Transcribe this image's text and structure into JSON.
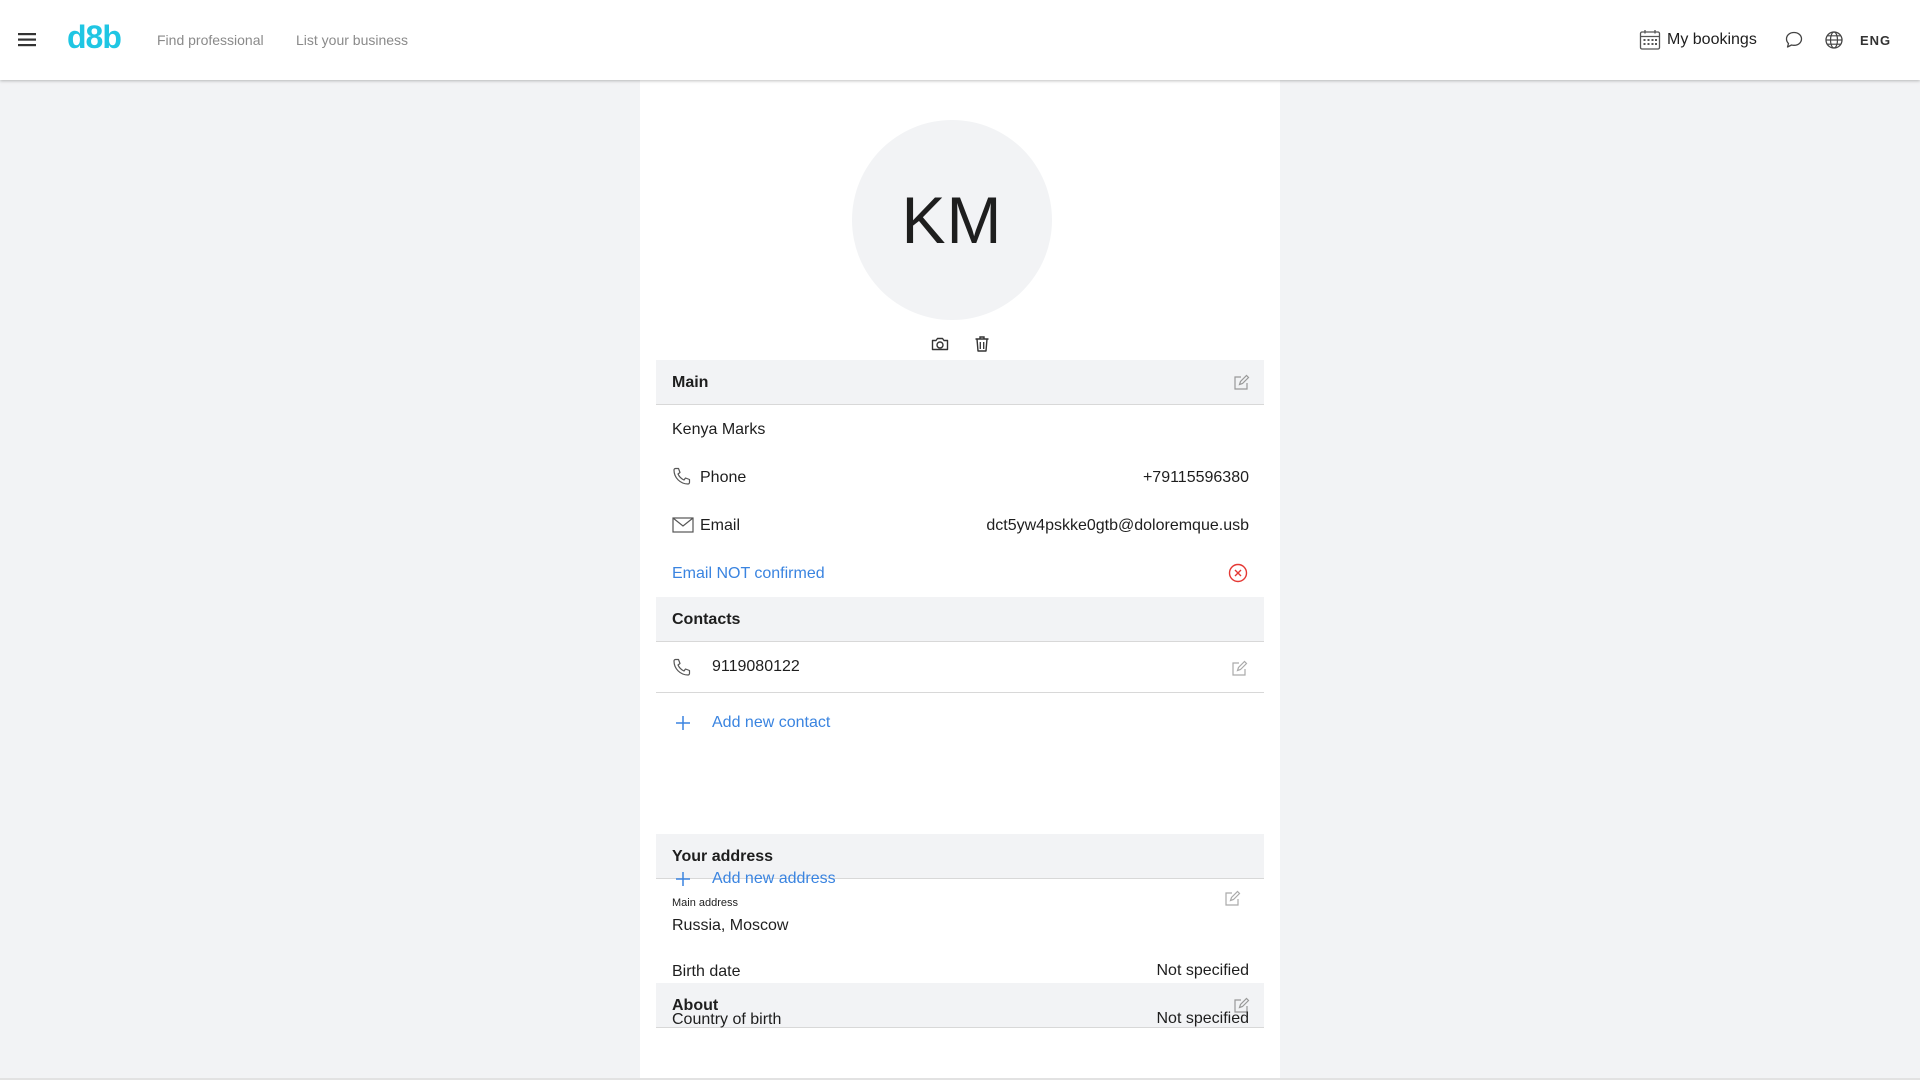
{
  "header": {
    "logo": "d8b",
    "nav": [
      "Find professional",
      "List your business"
    ],
    "bookings_label": "My bookings",
    "language": "ENG"
  },
  "profile": {
    "initials": "KM"
  },
  "main": {
    "title": "Main",
    "name": "Kenya Marks",
    "phone_label": "Phone",
    "phone_value": "+79115596380",
    "email_label": "Email",
    "email_value": "dct5yw4pskke0gtb@doloremque.usb",
    "email_status": "Email NOT confirmed"
  },
  "contacts": {
    "title": "Contacts",
    "items": [
      "9119080122"
    ],
    "add_label": "Add new contact"
  },
  "address": {
    "title": "Your address",
    "main_label": "Main address",
    "main_value": "Russia, Moscow",
    "add_label": "Add new address"
  },
  "about": {
    "title": "About",
    "birth_date_label": "Birth date",
    "birth_date_value": "Not specified",
    "country_label": "Country of birth",
    "country_value": "Not specified"
  },
  "colors": {
    "brand": "#1fc6e3",
    "link": "#3a84e0",
    "error": "#e53935",
    "background": "#f2f3f5"
  }
}
